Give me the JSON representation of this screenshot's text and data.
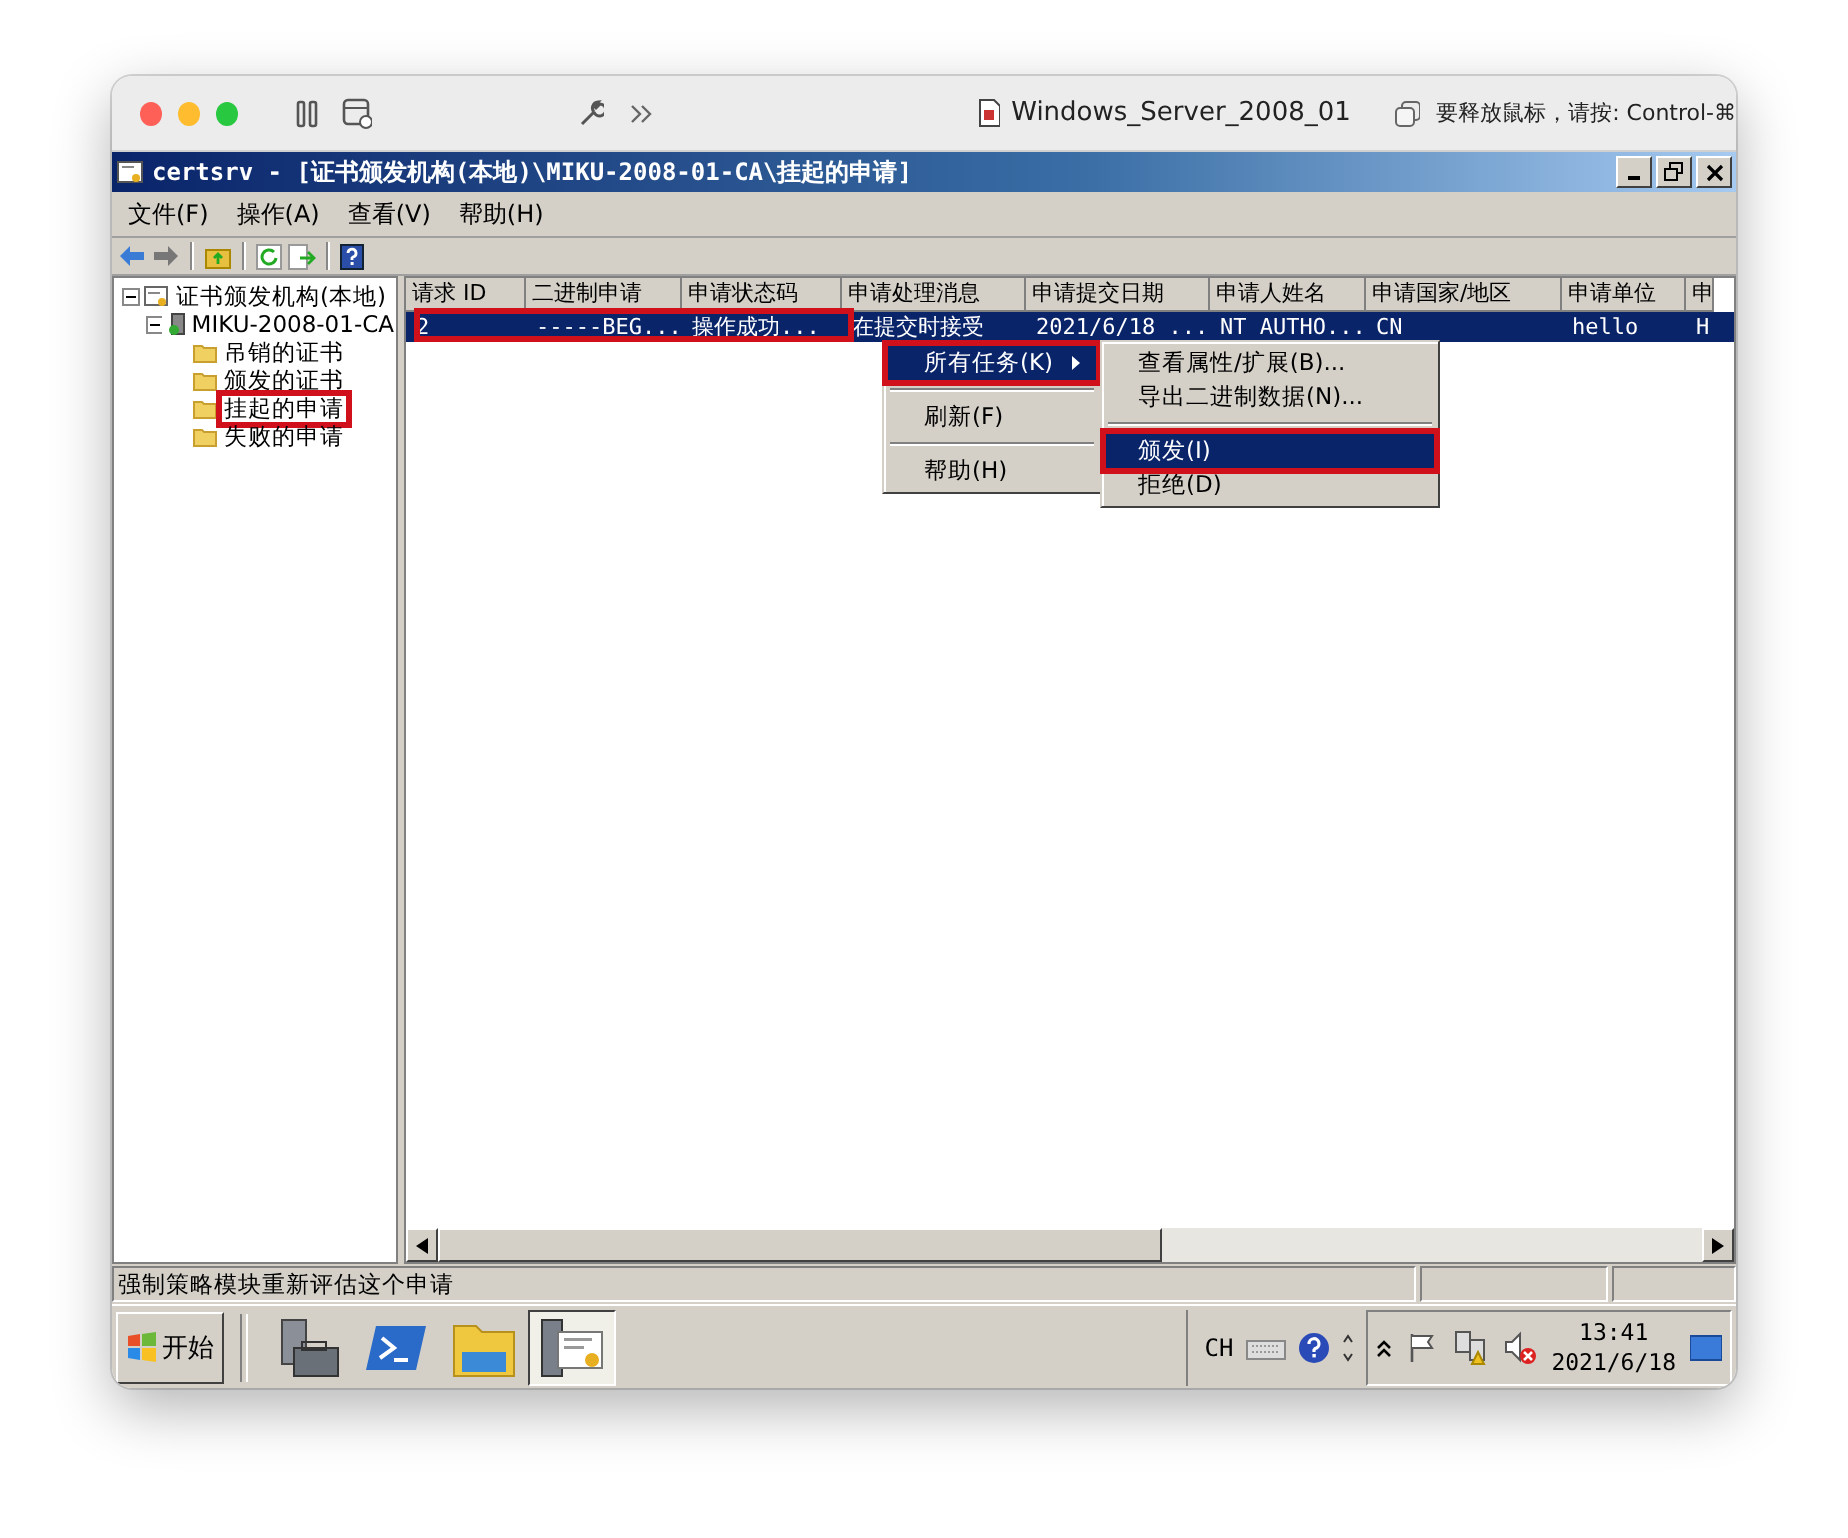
{
  "host_window": {
    "title": "Windows_Server_2008_01",
    "hint": "要释放鼠标，请按: Control-⌘"
  },
  "window": {
    "title": "certsrv - [证书颁发机构(本地)\\MIKU-2008-01-CA\\挂起的申请]"
  },
  "menu_bar": [
    "文件(F)",
    "操作(A)",
    "查看(V)",
    "帮助(H)"
  ],
  "tree": [
    {
      "label": "证书颁发机构(本地)",
      "kind": "root",
      "annotated": false,
      "expanded": true,
      "children": [
        {
          "label": "MIKU-2008-01-CA",
          "kind": "ca",
          "annotated": false,
          "expanded": true,
          "children": [
            {
              "label": "吊销的证书",
              "kind": "folder",
              "annotated": false
            },
            {
              "label": "颁发的证书",
              "kind": "folder",
              "annotated": false
            },
            {
              "label": "挂起的申请",
              "kind": "folder",
              "annotated": true
            },
            {
              "label": "失败的申请",
              "kind": "folder",
              "annotated": false
            }
          ]
        }
      ]
    }
  ],
  "table": {
    "columns": [
      "请求 ID",
      "二进制申请",
      "申请状态码",
      "申请处理消息",
      "申请提交日期",
      "申请人姓名",
      "申请国家/地区",
      "申请单位",
      "申"
    ],
    "rows": [
      {
        "selected": true,
        "annotated": true,
        "cells": [
          "2",
          "-----BEG...",
          "操作成功...",
          "在提交时接受",
          "2021/6/18 ...",
          "NT AUTHO...",
          "CN",
          "hello",
          "H"
        ]
      }
    ]
  },
  "context_menu": [
    {
      "kind": "item",
      "label": "所有任务(K)",
      "submenu": true,
      "selected": true,
      "annotated": true
    },
    {
      "kind": "separator"
    },
    {
      "kind": "item",
      "label": "刷新(F)",
      "submenu": false,
      "selected": false,
      "annotated": false
    },
    {
      "kind": "separator"
    },
    {
      "kind": "item",
      "label": "帮助(H)",
      "submenu": false,
      "selected": false,
      "annotated": false
    }
  ],
  "submenu": [
    {
      "kind": "item",
      "label": "查看属性/扩展(B)...",
      "selected": false,
      "annotated": false
    },
    {
      "kind": "item",
      "label": "导出二进制数据(N)...",
      "selected": false,
      "annotated": false
    },
    {
      "kind": "separator"
    },
    {
      "kind": "item",
      "label": "颁发(I)",
      "selected": true,
      "annotated": true
    },
    {
      "kind": "item",
      "label": "拒绝(D)",
      "selected": false,
      "annotated": false
    }
  ],
  "status_bar": {
    "text": "强制策略模块重新评估这个申请"
  },
  "taskbar": {
    "start": "开始",
    "apps": [
      {
        "kind": "server",
        "selected": false
      },
      {
        "kind": "powershell",
        "selected": false
      },
      {
        "kind": "explorer",
        "selected": false
      },
      {
        "kind": "certificate",
        "selected": true
      }
    ],
    "language": "CH",
    "time": "13:41",
    "date": "2021/6/18"
  }
}
